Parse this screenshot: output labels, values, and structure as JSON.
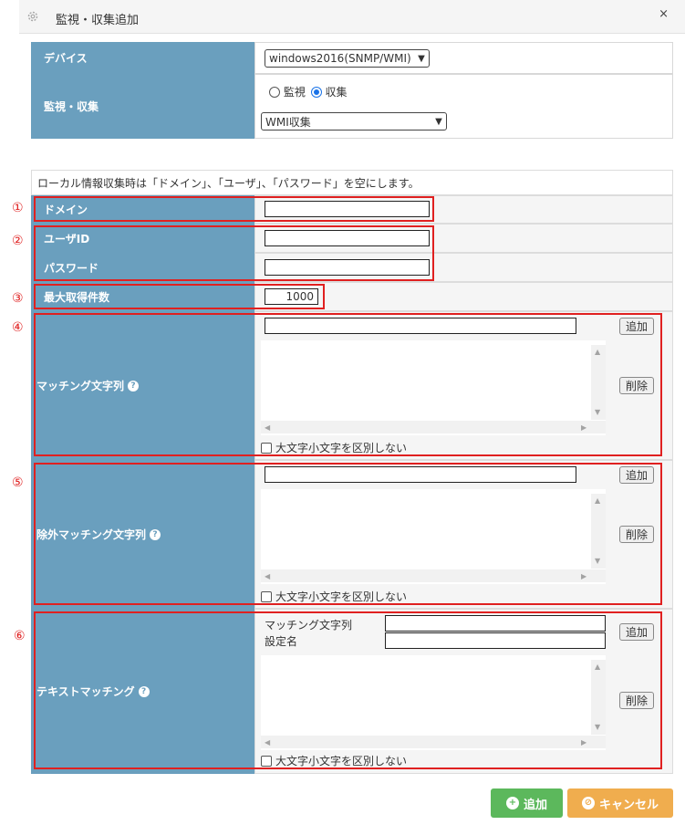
{
  "dialog": {
    "title": "監視・収集追加",
    "close": "×",
    "icon": "gear-icon"
  },
  "device": {
    "label": "デバイス",
    "value": "windows2016(SNMP/WMI)"
  },
  "mode": {
    "label": "監視・収集",
    "option_monitor": "監視",
    "option_collect": "収集",
    "selected": "収集",
    "method": "WMI収集"
  },
  "note": "ローカル情報収集時は「ドメイン」、「ユーザ」、「パスワード」を空にします。",
  "domain": {
    "label": "ドメイン",
    "value": ""
  },
  "user": {
    "label": "ユーザID",
    "value": ""
  },
  "password": {
    "label": "パスワード",
    "value": ""
  },
  "max_count": {
    "label": "最大取得件数",
    "value": "1000"
  },
  "match": {
    "label": "マッチング文字列",
    "add": "追加",
    "delete": "削除",
    "ignore_case": "大文字小文字を区別しない"
  },
  "exclude": {
    "label": "除外マッチング文字列",
    "add": "追加",
    "delete": "削除",
    "ignore_case": "大文字小文字を区別しない"
  },
  "text_match": {
    "label": "テキストマッチング",
    "match_label": "マッチング文字列",
    "setting_label": "設定名",
    "add": "追加",
    "delete": "削除",
    "ignore_case": "大文字小文字を区別しない"
  },
  "markers": [
    "①",
    "②",
    "③",
    "④",
    "⑤",
    "⑥"
  ],
  "footer": {
    "add": "追加",
    "cancel": "キャンセル"
  },
  "colors": {
    "label_bg": "#6a9fbe",
    "highlight": "#e02020",
    "add_button": "#5cb85c",
    "cancel_button": "#f0ad4e"
  }
}
